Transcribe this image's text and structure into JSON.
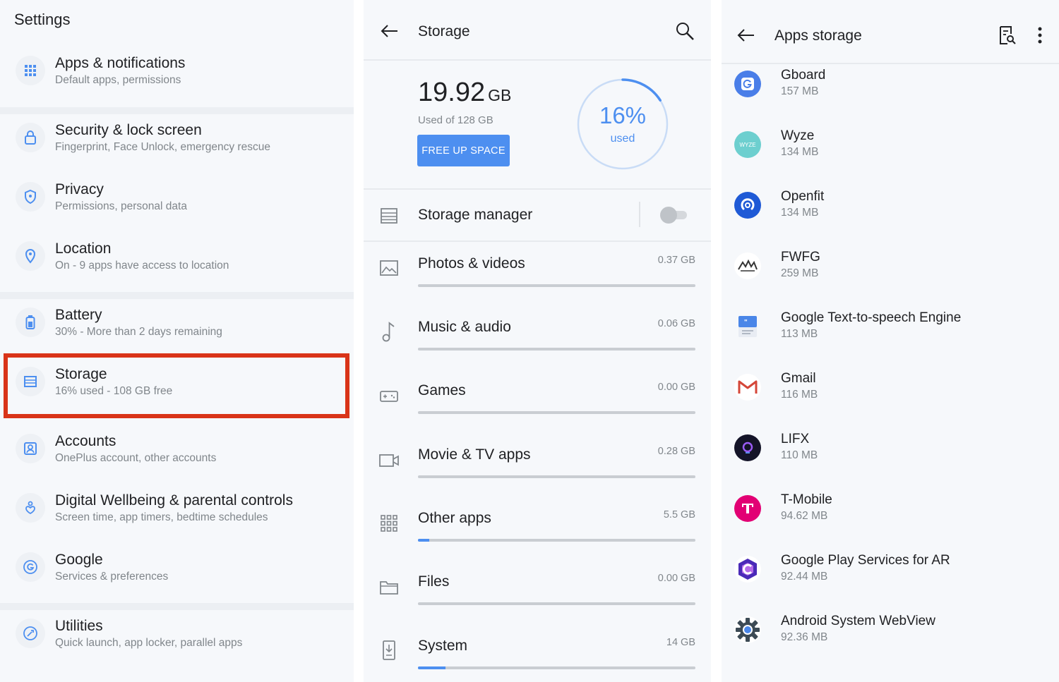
{
  "settings": {
    "title": "Settings",
    "items": [
      {
        "label": "Apps & notifications",
        "sub": "Default apps, permissions",
        "icon": "apps-grid-icon"
      },
      {
        "label": "Security & lock screen",
        "sub": "Fingerprint, Face Unlock, emergency rescue",
        "icon": "lock-icon"
      },
      {
        "label": "Privacy",
        "sub": "Permissions, personal data",
        "icon": "shield-icon"
      },
      {
        "label": "Location",
        "sub": "On - 9 apps have access to location",
        "icon": "location-pin-icon"
      },
      {
        "label": "Battery",
        "sub": "30% - More than 2 days remaining",
        "icon": "battery-icon"
      },
      {
        "label": "Storage",
        "sub": "16% used - 108 GB free",
        "icon": "storage-icon",
        "highlighted": true
      },
      {
        "label": "Accounts",
        "sub": "OnePlus account, other accounts",
        "icon": "account-icon"
      },
      {
        "label": "Digital Wellbeing & parental controls",
        "sub": "Screen time, app timers, bedtime schedules",
        "icon": "wellbeing-icon"
      },
      {
        "label": "Google",
        "sub": "Services & preferences",
        "icon": "google-icon"
      },
      {
        "label": "Utilities",
        "sub": "Quick launch, app locker, parallel apps",
        "icon": "utilities-icon"
      }
    ],
    "highlight_color": "#d93418"
  },
  "storage": {
    "title": "Storage",
    "used_value": "19.92",
    "used_unit": "GB",
    "used_of": "Used of 128 GB",
    "free_button": "FREE UP SPACE",
    "percent_label": "16%",
    "percent_sub": "used",
    "percent_used": 0.16,
    "manager_label": "Storage manager",
    "manager_enabled": false,
    "categories": [
      {
        "label": "Photos & videos",
        "size": "0.37 GB",
        "fraction": 0.0,
        "icon": "image-icon"
      },
      {
        "label": "Music & audio",
        "size": "0.06 GB",
        "fraction": 0.0,
        "icon": "music-note-icon"
      },
      {
        "label": "Games",
        "size": "0.00 GB",
        "fraction": 0.0,
        "icon": "gamepad-icon"
      },
      {
        "label": "Movie & TV apps",
        "size": "0.28 GB",
        "fraction": 0.0,
        "icon": "video-camera-icon"
      },
      {
        "label": "Other apps",
        "size": "5.5 GB",
        "fraction": 0.04,
        "icon": "apps-grid-icon"
      },
      {
        "label": "Files",
        "size": "0.00 GB",
        "fraction": 0.0,
        "icon": "folder-icon"
      },
      {
        "label": "System",
        "size": "14 GB",
        "fraction": 0.1,
        "icon": "system-download-icon"
      }
    ],
    "accent": "#4d8ff0"
  },
  "apps_storage": {
    "title": "Apps storage",
    "apps": [
      {
        "name": "Gboard",
        "size": "157 MB",
        "icon": "gboard-icon",
        "color": "#4a7ee8"
      },
      {
        "name": "Wyze",
        "size": "134 MB",
        "icon": "wyze-icon",
        "color": "#6dcfcf",
        "glyph": "WYZE"
      },
      {
        "name": "Openfit",
        "size": "134 MB",
        "icon": "openfit-icon",
        "color": "#1f5ad6"
      },
      {
        "name": "FWFG",
        "size": "259 MB",
        "icon": "fwfg-icon",
        "color": "#ffffff"
      },
      {
        "name": "Google Text-to-speech Engine",
        "size": "113 MB",
        "icon": "tts-icon",
        "color": "#4a86e8"
      },
      {
        "name": "Gmail",
        "size": "116 MB",
        "icon": "gmail-icon",
        "color": "#ffffff"
      },
      {
        "name": "LIFX",
        "size": "110 MB",
        "icon": "lifx-icon",
        "color": "#141428"
      },
      {
        "name": "T-Mobile",
        "size": "94.62 MB",
        "icon": "tmobile-icon",
        "color": "#e20074"
      },
      {
        "name": "Google Play Services for AR",
        "size": "92.44 MB",
        "icon": "arcore-icon",
        "color": "#ffffff"
      },
      {
        "name": "Android System WebView",
        "size": "92.36 MB",
        "icon": "webview-icon",
        "color": "#ffffff"
      }
    ]
  }
}
